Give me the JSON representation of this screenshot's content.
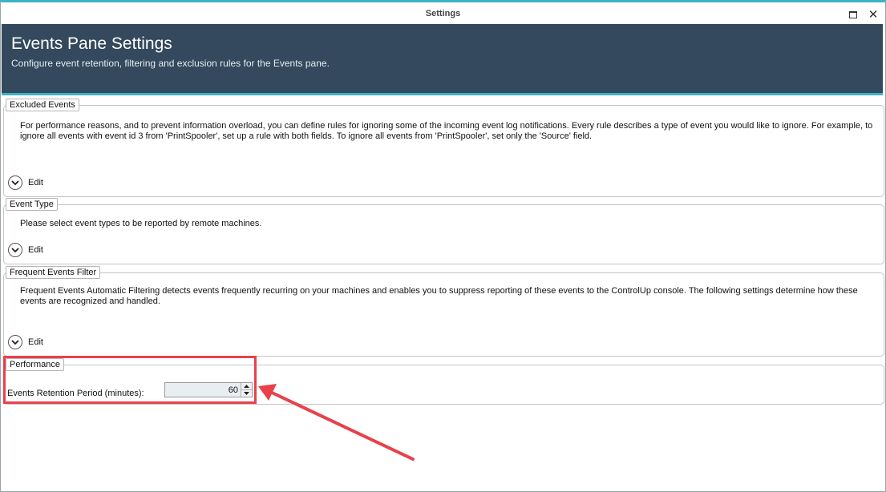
{
  "window": {
    "title": "Settings"
  },
  "header": {
    "title": "Events Pane Settings",
    "subtitle": "Configure event retention, filtering and exclusion rules for the Events pane."
  },
  "sections": {
    "excluded": {
      "legend": "Excluded Events",
      "description": "For performance reasons, and to prevent information overload, you can define rules for ignoring some of the incoming event log notifications. Every rule describes a type of event you would like to ignore. For example, to ignore all events with event id 3 from 'PrintSpooler', set up a rule with both fields. To ignore all events from 'PrintSpooler', set only the 'Source' field.",
      "edit_label": "Edit"
    },
    "event_type": {
      "legend": "Event Type",
      "description": "Please select event types to be reported by remote machines.",
      "edit_label": "Edit"
    },
    "frequent": {
      "legend": "Frequent Events Filter",
      "description": "Frequent Events Automatic Filtering detects events frequently recurring on your machines and enables you to suppress reporting of these events to the ControlUp console. The following settings determine how these events are recognized and handled.",
      "edit_label": "Edit"
    },
    "performance": {
      "legend": "Performance",
      "retention_label": "Events Retention Period (minutes):",
      "retention_value": "60"
    }
  },
  "colors": {
    "header_bg": "#34495e",
    "accent": "#3bb3c3",
    "annotation": "#e8414c"
  }
}
